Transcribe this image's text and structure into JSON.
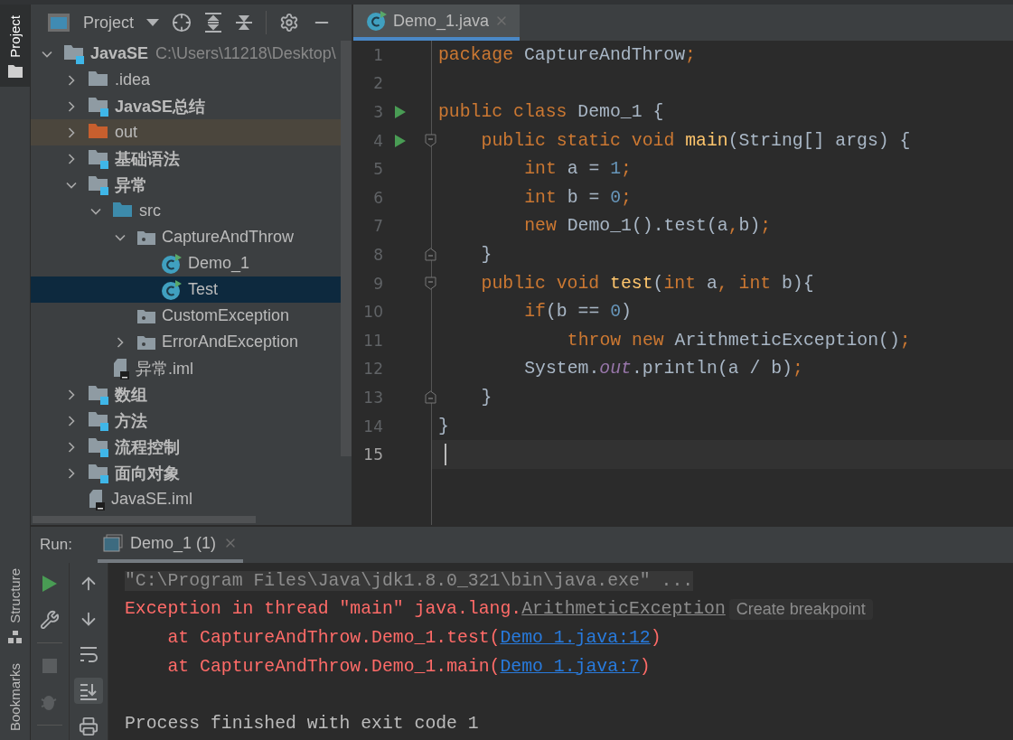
{
  "tool_strip": {
    "top": [
      {
        "label": "Project",
        "selected": true
      }
    ],
    "bottom": [
      {
        "label": "Structure",
        "selected": false
      },
      {
        "label": "Bookmarks",
        "selected": false
      }
    ]
  },
  "project_panel": {
    "title": "Project",
    "tree": [
      {
        "kind": "module",
        "label": "JavaSE",
        "path": "C:\\Users\\11218\\Desktop\\",
        "expanded": true,
        "selected": false,
        "children": [
          {
            "kind": "folder",
            "label": ".idea",
            "expanded": false,
            "selected": false
          },
          {
            "kind": "module",
            "label": "JavaSE总结",
            "expanded": false,
            "selected": false
          },
          {
            "kind": "excluded",
            "label": "out",
            "expanded": false,
            "selected": false
          },
          {
            "kind": "module",
            "label": "基础语法",
            "expanded": false,
            "selected": false
          },
          {
            "kind": "module",
            "label": "异常",
            "expanded": true,
            "selected": false,
            "children": [
              {
                "kind": "source",
                "label": "src",
                "expanded": true,
                "selected": false,
                "children": [
                  {
                    "kind": "package",
                    "label": "CaptureAndThrow",
                    "expanded": true,
                    "selected": false,
                    "children": [
                      {
                        "kind": "class",
                        "label": "Demo_1",
                        "selected": false
                      },
                      {
                        "kind": "class",
                        "label": "Test",
                        "selected": true
                      }
                    ]
                  },
                  {
                    "kind": "package",
                    "label": "CustomException",
                    "selected": false
                  },
                  {
                    "kind": "package",
                    "label": "ErrorAndException",
                    "expanded": false,
                    "selected": false
                  }
                ]
              },
              {
                "kind": "iml",
                "label": "异常.iml",
                "selected": false
              }
            ]
          },
          {
            "kind": "module",
            "label": "数组",
            "expanded": false,
            "selected": false
          },
          {
            "kind": "module",
            "label": "方法",
            "expanded": false,
            "selected": false
          },
          {
            "kind": "module",
            "label": "流程控制",
            "expanded": false,
            "selected": false
          },
          {
            "kind": "module",
            "label": "面向对象",
            "expanded": false,
            "selected": false
          },
          {
            "kind": "iml",
            "label": "JavaSE.iml",
            "selected": false
          }
        ]
      }
    ]
  },
  "editor": {
    "tabs": [
      {
        "label": "Demo_1.java",
        "selected": true
      }
    ],
    "lines": [
      {
        "number": "1",
        "run": false,
        "current": false,
        "tokens": [
          {
            "kind": "keyword",
            "text": "package "
          },
          {
            "kind": "plain",
            "text": "CaptureAndThrow"
          },
          {
            "kind": "keyword",
            "text": ";"
          }
        ]
      },
      {
        "number": "2",
        "run": false,
        "current": false
      },
      {
        "number": "3",
        "run": true,
        "current": false,
        "tokens": [
          {
            "kind": "keyword",
            "text": "public class "
          },
          {
            "kind": "plain",
            "text": "Demo_1 {"
          }
        ],
        "children": [
          {
            "kind": "opener",
            "number": "4",
            "run": true,
            "current": false,
            "tokens": [
              {
                "kind": "keyword",
                "text": "public static void "
              },
              {
                "kind": "method",
                "text": "main"
              },
              {
                "kind": "plain",
                "text": "(String[] args) {"
              }
            ],
            "children": [
              {
                "number": "5",
                "run": false,
                "current": false,
                "tokens": [
                  {
                    "kind": "keyword",
                    "text": "int "
                  },
                  {
                    "kind": "plain",
                    "text": "a = "
                  },
                  {
                    "kind": "number",
                    "text": "1"
                  },
                  {
                    "kind": "keyword",
                    "text": ";"
                  }
                ]
              },
              {
                "number": "6",
                "run": false,
                "current": false,
                "tokens": [
                  {
                    "kind": "keyword",
                    "text": "int "
                  },
                  {
                    "kind": "plain",
                    "text": "b = "
                  },
                  {
                    "kind": "number",
                    "text": "0"
                  },
                  {
                    "kind": "keyword",
                    "text": ";"
                  }
                ]
              },
              {
                "number": "7",
                "run": false,
                "current": false,
                "tokens": [
                  {
                    "kind": "keyword",
                    "text": "new "
                  },
                  {
                    "kind": "plain",
                    "text": "Demo_1().test(a"
                  },
                  {
                    "kind": "keyword",
                    "text": ","
                  },
                  {
                    "kind": "plain",
                    "text": "b)"
                  },
                  {
                    "kind": "keyword",
                    "text": ";"
                  }
                ]
              }
            ]
          },
          {
            "kind": "closer",
            "number": "8",
            "run": false,
            "current": false,
            "tokens": [
              {
                "kind": "plain",
                "text": "}"
              }
            ]
          },
          {
            "kind": "opener",
            "number": "9",
            "run": false,
            "current": false,
            "tokens": [
              {
                "kind": "keyword",
                "text": "public void "
              },
              {
                "kind": "method",
                "text": "test"
              },
              {
                "kind": "plain",
                "text": "("
              },
              {
                "kind": "keyword",
                "text": "int "
              },
              {
                "kind": "plain",
                "text": "a"
              },
              {
                "kind": "keyword",
                "text": ", int "
              },
              {
                "kind": "plain",
                "text": "b){"
              }
            ],
            "children": [
              {
                "number": "10",
                "run": false,
                "current": false,
                "tokens": [
                  {
                    "kind": "keyword",
                    "text": "if"
                  },
                  {
                    "kind": "plain",
                    "text": "(b == "
                  },
                  {
                    "kind": "number",
                    "text": "0"
                  },
                  {
                    "kind": "plain",
                    "text": ")"
                  }
                ],
                "children": [
                  {
                    "number": "11",
                    "run": false,
                    "current": false,
                    "tokens": [
                      {
                        "kind": "keyword",
                        "text": "throw new "
                      },
                      {
                        "kind": "plain",
                        "text": "ArithmeticException()"
                      },
                      {
                        "kind": "keyword",
                        "text": ";"
                      }
                    ]
                  }
                ]
              },
              {
                "number": "12",
                "run": false,
                "current": false,
                "tokens": [
                  {
                    "kind": "plain",
                    "text": "System."
                  },
                  {
                    "kind": "field",
                    "text": "out"
                  },
                  {
                    "kind": "plain",
                    "text": ".println(a / b)"
                  },
                  {
                    "kind": "keyword",
                    "text": ";"
                  }
                ]
              }
            ]
          },
          {
            "kind": "closer",
            "number": "13",
            "run": false,
            "current": false,
            "tokens": [
              {
                "kind": "plain",
                "text": "}"
              }
            ]
          }
        ]
      },
      {
        "number": "14",
        "run": false,
        "current": false,
        "tokens": [
          {
            "kind": "plain",
            "text": "}"
          }
        ]
      },
      {
        "number": "15",
        "run": false,
        "current": true
      }
    ]
  },
  "run_panel": {
    "label": "Run:",
    "tabs": [
      {
        "label": "Demo_1 (1)",
        "selected": true
      }
    ],
    "console": [
      {
        "kind": "command",
        "text": "\"C:\\Program Files\\Java\\jdk1.8.0_321\\bin\\java.exe\" ..."
      },
      {
        "kind": "error",
        "segments": [
          {
            "kind": "text",
            "text": "Exception in thread \"main\" java.lang."
          },
          {
            "kind": "exception",
            "text": "ArithmeticException"
          }
        ],
        "hint": "Create breakpoint"
      },
      {
        "kind": "trace",
        "segments": [
          {
            "kind": "text",
            "text": "at CaptureAndThrow.Demo_1.test("
          },
          {
            "kind": "link",
            "text": "Demo_1.java:12"
          },
          {
            "kind": "text",
            "text": ")"
          }
        ]
      },
      {
        "kind": "trace",
        "segments": [
          {
            "kind": "text",
            "text": "at CaptureAndThrow.Demo_1.main("
          },
          {
            "kind": "link",
            "text": "Demo_1.java:7"
          },
          {
            "kind": "text",
            "text": ")"
          }
        ]
      },
      {
        "kind": "blank"
      },
      {
        "kind": "output",
        "text": "Process finished with exit code 1"
      }
    ]
  }
}
